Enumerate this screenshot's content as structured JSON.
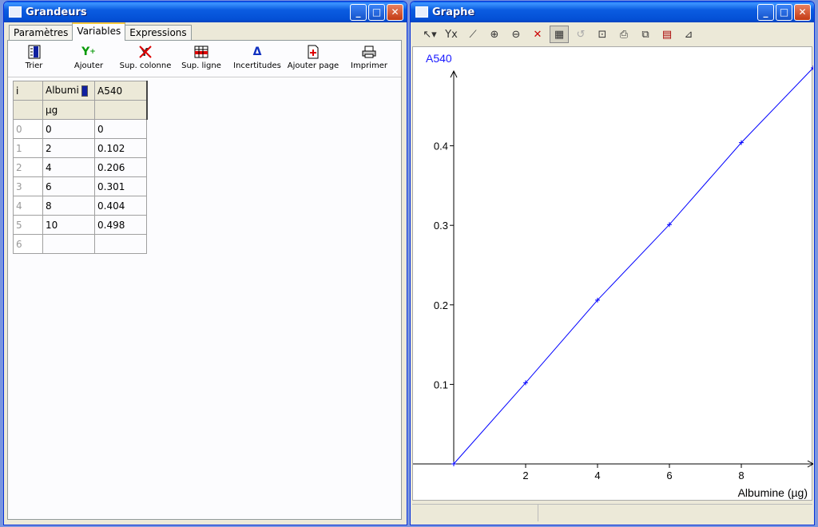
{
  "left_window": {
    "title": "Grandeurs",
    "tabs": [
      {
        "label": "Paramètres"
      },
      {
        "label": "Variables"
      },
      {
        "label": "Expressions"
      }
    ],
    "toolbar": [
      {
        "label": "Trier",
        "icon": "sort-icon"
      },
      {
        "label": "Ajouter",
        "icon": "add-variable-icon"
      },
      {
        "label": "Sup. colonne",
        "icon": "delete-column-icon"
      },
      {
        "label": "Sup. ligne",
        "icon": "delete-row-icon"
      },
      {
        "label": "Incertitudes",
        "icon": "delta-icon"
      },
      {
        "label": "Ajouter page",
        "icon": "add-page-icon"
      },
      {
        "label": "Imprimer",
        "icon": "printer-icon"
      }
    ],
    "grid": {
      "index_header": "i",
      "columns": [
        {
          "name": "Albumi",
          "unit": "µg"
        },
        {
          "name": "A540",
          "unit": ""
        }
      ],
      "rows": [
        {
          "i": "0",
          "x": "0",
          "y": "0"
        },
        {
          "i": "1",
          "x": "2",
          "y": "0.102"
        },
        {
          "i": "2",
          "x": "4",
          "y": "0.206"
        },
        {
          "i": "3",
          "x": "6",
          "y": "0.301"
        },
        {
          "i": "4",
          "x": "8",
          "y": "0.404"
        },
        {
          "i": "5",
          "x": "10",
          "y": "0.498"
        },
        {
          "i": "6",
          "x": "",
          "y": ""
        }
      ]
    }
  },
  "right_window": {
    "title": "Graphe",
    "toolbar_icons": [
      "cursor-icon",
      "axes-select-icon",
      "fit-line-icon",
      "zoom-in-icon",
      "zoom-out-icon",
      "zoom-reset-icon",
      "grid-icon",
      "undo-icon",
      "model-icon",
      "print-icon",
      "copy-icon",
      "film-icon",
      "tangent-icon"
    ]
  },
  "chart_data": {
    "type": "line",
    "ylabel": "A540",
    "xlabel": "Albumine (µg)",
    "x": [
      0,
      2,
      4,
      6,
      8,
      10
    ],
    "series": [
      {
        "values": [
          0,
          0.102,
          0.206,
          0.301,
          0.404,
          0.498
        ]
      }
    ],
    "xlim": [
      0,
      10
    ],
    "ylim": [
      0,
      0.5
    ],
    "xticks": [
      "2",
      "4",
      "6",
      "8"
    ],
    "yticks": [
      "0.1",
      "0.2",
      "0.3",
      "0.4"
    ],
    "line_color": "#0000ff",
    "grid": false
  }
}
